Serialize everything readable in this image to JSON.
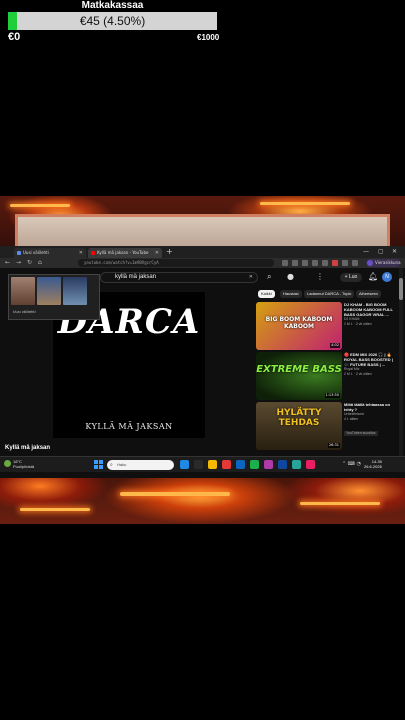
{
  "donation_goal": {
    "title": "Matkakassaa",
    "amount_label": "€45 (4.50%)",
    "progress_percent": 4.5,
    "min_label": "€0",
    "max_label": "€1000",
    "fill_color": "#1fcf3a",
    "track_color": "#d4d4d4"
  },
  "browser": {
    "tabs": [
      {
        "label": "Uusi välilehti",
        "active": false
      },
      {
        "label": "Kyllä mä jaksan - YouTube",
        "active": true
      }
    ],
    "new_tab_label": "+",
    "window_controls": [
      "—",
      "▢",
      "✕"
    ],
    "url": "youtube.com/watch?v=1m9BVgcrCyA",
    "profile_label": "Vierasikkuna"
  },
  "youtube": {
    "search_value": "kyllä mä jaksan",
    "create_label": "+ Luo",
    "avatar_letter": "N",
    "player": {
      "brand": "DARCA",
      "subtitle": "KYLLÄ MÄ JAKSAN"
    },
    "video_title": "Kyllä mä jaksan",
    "pip_label": "Uusi välilehti",
    "chips": [
      {
        "label": "Kaikki",
        "active": true
      },
      {
        "label": "Haustasi",
        "active": false
      },
      {
        "label": "Ladannut DARCA - Topic",
        "active": false
      },
      {
        "label": "Aiheeseen",
        "active": false
      }
    ],
    "recommendations": [
      {
        "thumb_text": "BIG BOOM KABOOM KABOOM",
        "thumb_colors": [
          "#f0c000",
          "#e02080"
        ],
        "title": "DJ KHAM - BIG BOOM KABOOM KABOOM FULL BASS GAGOR VIRAL ...",
        "channel": "DJ KHAM",
        "meta": "1 M t. · 2 vk sitten",
        "duration": "4:02"
      },
      {
        "thumb_text": "EXTREME BASS",
        "thumb_colors": [
          "#1a3a10",
          "#70e030"
        ],
        "title": "🔴 EDM MIX 2026 🎧 | 🔥 ROYAL BASS BOOSTED | 🎶 FUTURE BASS | ...",
        "channel": "Royal Mix",
        "meta": "2 M t. · 2 vk sitten",
        "duration": "1:13:50"
      },
      {
        "thumb_text": "HYLÄTTY TEHDAS",
        "thumb_colors": [
          "#4a3a20",
          "#f0c020"
        ],
        "title": "Miltä täällä tehtaassa on tehty ?",
        "channel": "Urbexfinland",
        "meta": "4 t. sitten",
        "badge": "YouTuben suositus",
        "duration": "26:31"
      }
    ]
  },
  "taskbar": {
    "weather_temp": "18°C",
    "weather_text": "Puolipilvistä",
    "search_placeholder": "Haku",
    "time": "14.35",
    "date": "26.6.2026",
    "app_colors": [
      "#1e88e5",
      "#2a2a2a",
      "#f5b800",
      "#e53935",
      "#0a66c2",
      "#1ab04c",
      "#b03aa8",
      "#0d47a1",
      "#26a69a",
      "#e91e63"
    ]
  }
}
